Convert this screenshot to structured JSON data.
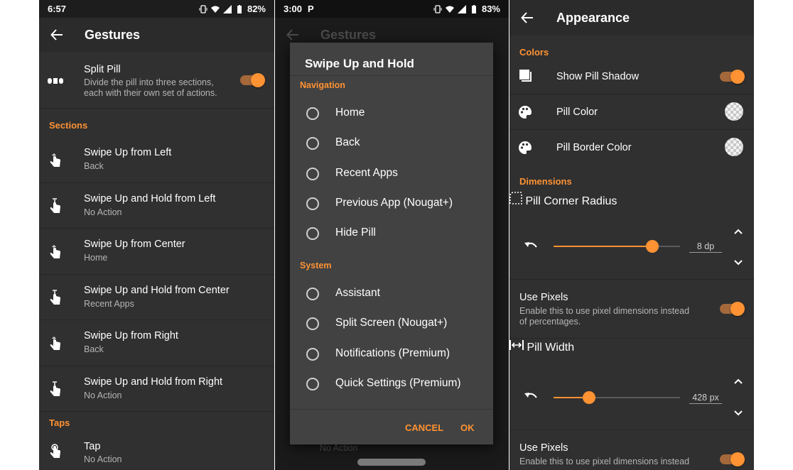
{
  "colors": {
    "accent": "#ff9233",
    "background": "#303030",
    "dialog": "#424242"
  },
  "phone1": {
    "status": {
      "time": "6:57",
      "battery": "82%"
    },
    "title": "Gestures",
    "split_pill": {
      "title": "Split Pill",
      "subtitle_line1": "Divide the pill into three sections,",
      "subtitle_line2": "each with their own set of actions.",
      "enabled": true
    },
    "sections_header": "Sections",
    "gestures": [
      {
        "title": "Swipe Up from Left",
        "value": "Back",
        "icon": "swipe-up-icon"
      },
      {
        "title": "Swipe Up and Hold from Left",
        "value": "No Action",
        "icon": "swipe-up-hold-icon"
      },
      {
        "title": "Swipe Up from Center",
        "value": "Home",
        "icon": "swipe-up-icon"
      },
      {
        "title": "Swipe Up and Hold from Center",
        "value": "Recent Apps",
        "icon": "swipe-up-hold-icon"
      },
      {
        "title": "Swipe Up from Right",
        "value": "Back",
        "icon": "swipe-up-icon"
      },
      {
        "title": "Swipe Up and Hold from Right",
        "value": "No Action",
        "icon": "swipe-up-hold-icon"
      }
    ],
    "taps_header": "Taps",
    "tap": {
      "title": "Tap",
      "value": "No Action",
      "icon": "tap-icon"
    }
  },
  "phone2": {
    "status": {
      "time": "3:00",
      "battery": "83%"
    },
    "bg_title": "Gestures",
    "bg_last_value": "No Action",
    "dialog": {
      "title": "Swipe Up and Hold",
      "navigation_header": "Navigation",
      "navigation_options": [
        "Home",
        "Back",
        "Recent Apps",
        "Previous App (Nougat+)",
        "Hide Pill"
      ],
      "system_header": "System",
      "system_options": [
        "Assistant",
        "Split Screen (Nougat+)",
        "Notifications (Premium)",
        "Quick Settings (Premium)"
      ],
      "cancel": "CANCEL",
      "ok": "OK"
    }
  },
  "phone3": {
    "title": "Appearance",
    "colors_header": "Colors",
    "show_shadow": {
      "title": "Show Pill Shadow",
      "enabled": true
    },
    "pill_color": {
      "title": "Pill Color"
    },
    "pill_border_color": {
      "title": "Pill Border Color"
    },
    "dimensions_header": "Dimensions",
    "corner_radius": {
      "title": "Pill Corner Radius",
      "value": "8 dp",
      "fraction": 0.78
    },
    "use_pixels_1": {
      "title": "Use Pixels",
      "subtitle_line1": "Enable this to use pixel dimensions instead",
      "subtitle_line2": "of percentages.",
      "enabled": true
    },
    "pill_width": {
      "title": "Pill Width",
      "value": "428 px",
      "fraction": 0.28
    },
    "use_pixels_2": {
      "title": "Use Pixels",
      "subtitle_line1": "Enable this to use pixel dimensions instead",
      "enabled": true
    }
  }
}
